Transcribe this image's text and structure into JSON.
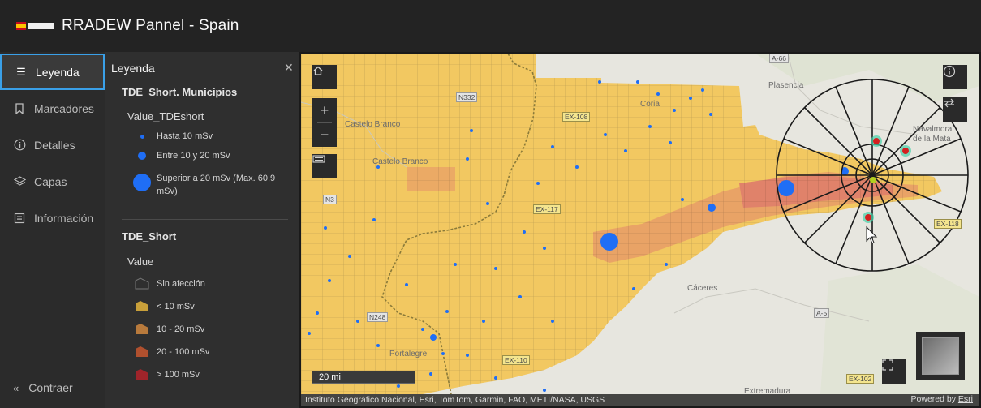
{
  "header": {
    "title": "RRADEW Pannel - Spain"
  },
  "actions": [
    {
      "label": "Leyenda",
      "icon": "list-icon",
      "active": true
    },
    {
      "label": "Marcadores",
      "icon": "bookmark-icon",
      "active": false
    },
    {
      "label": "Detalles",
      "icon": "info-icon",
      "active": false
    },
    {
      "label": "Capas",
      "icon": "layers-icon",
      "active": false
    },
    {
      "label": "Información",
      "icon": "info-doc-icon",
      "active": false
    }
  ],
  "collapse_label": "Contraer",
  "legend": {
    "title": "Leyenda",
    "layer1": {
      "title": "TDE_Short. Municipios",
      "field": "Value_TDEshort",
      "items": [
        {
          "label": "Hasta 10 mSv"
        },
        {
          "label": "Entre 10 y 20 mSv"
        },
        {
          "label": "Superior a 20 mSv (Max. 60,9 mSv)"
        }
      ]
    },
    "layer2": {
      "title": "TDE_Short",
      "field": "Value",
      "items": [
        {
          "label": "Sin afección",
          "color": "transparent"
        },
        {
          "label": "< 10 mSv",
          "color": "#c9a03a"
        },
        {
          "label": "10 - 20 mSv",
          "color": "#b87a3c"
        },
        {
          "label": "20 - 100 mSv",
          "color": "#b0502e"
        },
        {
          "label": "> 100 mSv",
          "color": "#a0242a"
        }
      ]
    }
  },
  "map": {
    "scale_label": "20 mi",
    "attribution": "Instituto Geográfico Nacional, Esri, TomTom, Garmin, FAO, METI/NASA, USGS",
    "powered_prefix": "Powered by ",
    "powered_brand": "Esri",
    "places": {
      "plasencia": "Plasencia",
      "castelo1": "Castelo Branco",
      "castelo2": "Castelo Branco",
      "coria": "Coria",
      "navalmoral": "Navalmoral de la Mata",
      "caceres": "Cáceres",
      "portalegre": "Portalegre",
      "extremadura": "Extremadura"
    },
    "roads": {
      "a66": "A-66",
      "n332": "N332",
      "ex108": "EX-108",
      "ex117": "EX-117",
      "n3": "N3",
      "n248": "N248",
      "ex110": "EX-110",
      "a5": "A-5",
      "ex102": "EX-102",
      "ex118": "EX-118"
    },
    "colors": {
      "fill_low": "#f2c861",
      "fill_mid": "#e9a366",
      "fill_high": "#e0826a",
      "point": "#1f6ef5",
      "accent": "#3aa0e8"
    }
  }
}
